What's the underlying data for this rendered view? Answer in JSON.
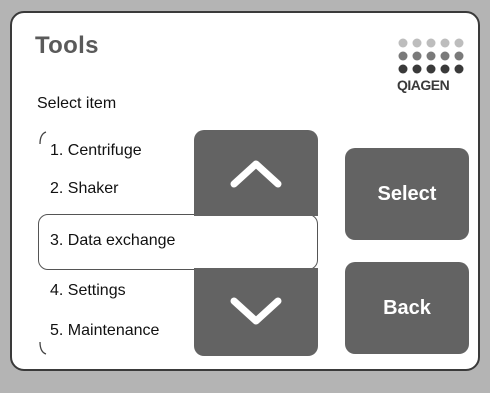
{
  "screen": {
    "title": "Tools",
    "subtitle": "Select item",
    "logo_text": "QIAGEN"
  },
  "list": {
    "items": [
      {
        "label": "1. Centrifuge"
      },
      {
        "label": "2. Shaker"
      },
      {
        "label": "3. Data exchange",
        "selected": true
      },
      {
        "label": "4. Settings"
      },
      {
        "label": "5. Maintenance"
      }
    ]
  },
  "buttons": {
    "select_label": "Select",
    "back_label": "Back",
    "scroll_up_icon": "chevron-up-icon",
    "scroll_down_icon": "chevron-down-icon"
  },
  "colors": {
    "button": "#636363",
    "background": "#b4b4b4",
    "panel": "#ffffff"
  }
}
